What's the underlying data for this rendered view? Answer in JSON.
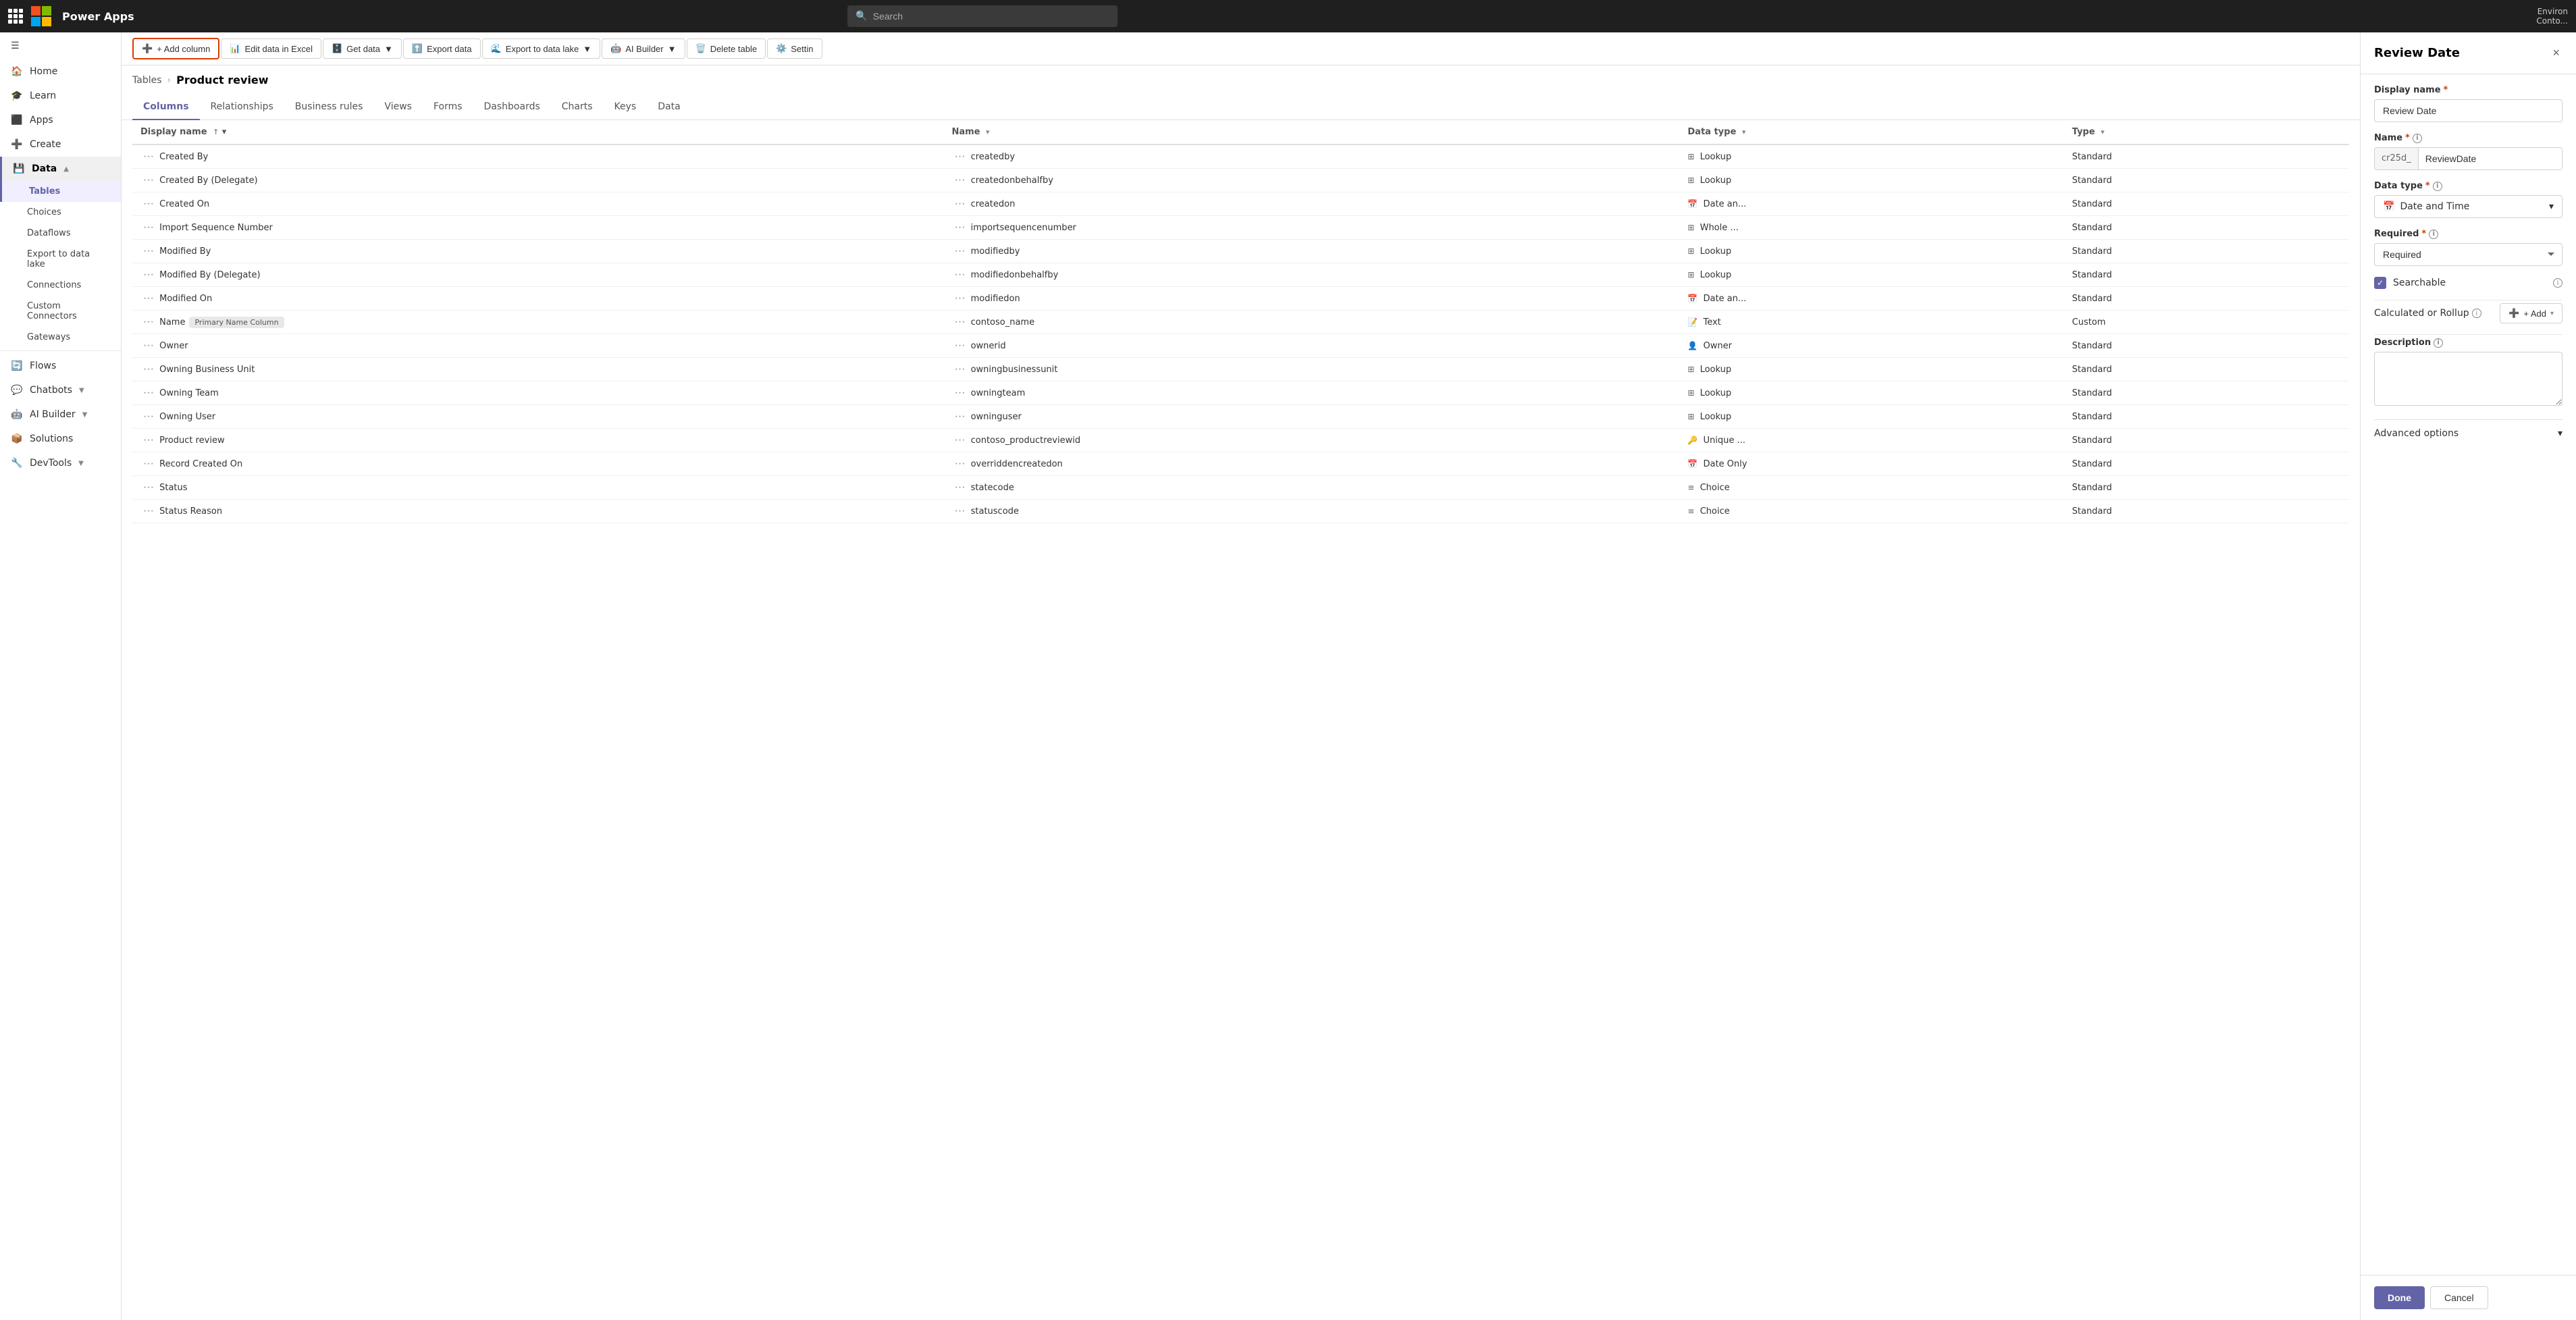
{
  "topNav": {
    "appName": "Power Apps",
    "searchPlaceholder": "Search",
    "envLabel": "Environ",
    "envUser": "Conto..."
  },
  "sidebar": {
    "menuItems": [
      {
        "id": "home",
        "label": "Home",
        "icon": "🏠",
        "active": false
      },
      {
        "id": "learn",
        "label": "Learn",
        "icon": "🎓",
        "active": false
      },
      {
        "id": "apps",
        "label": "Apps",
        "icon": "⬛",
        "active": false
      },
      {
        "id": "create",
        "label": "Create",
        "icon": "➕",
        "active": false
      },
      {
        "id": "data",
        "label": "Data",
        "icon": "💾",
        "active": true,
        "expanded": true
      }
    ],
    "dataSubItems": [
      {
        "id": "tables",
        "label": "Tables",
        "active": true
      },
      {
        "id": "choices",
        "label": "Choices",
        "active": false
      },
      {
        "id": "dataflows",
        "label": "Dataflows",
        "active": false
      },
      {
        "id": "export",
        "label": "Export to data lake",
        "active": false
      },
      {
        "id": "connections",
        "label": "Connections",
        "active": false
      },
      {
        "id": "customConnectors",
        "label": "Custom Connectors",
        "active": false
      },
      {
        "id": "gateways",
        "label": "Gateways",
        "active": false
      }
    ],
    "otherItems": [
      {
        "id": "flows",
        "label": "Flows",
        "icon": "🔄",
        "active": false
      },
      {
        "id": "chatbots",
        "label": "Chatbots",
        "icon": "💬",
        "active": false,
        "expandable": true
      },
      {
        "id": "aiBuilder",
        "label": "AI Builder",
        "icon": "🤖",
        "active": false,
        "expandable": true
      },
      {
        "id": "solutions",
        "label": "Solutions",
        "icon": "📦",
        "active": false
      },
      {
        "id": "devTools",
        "label": "DevTools",
        "icon": "🔧",
        "active": false,
        "expandable": true
      }
    ]
  },
  "breadcrumb": {
    "parent": "Tables",
    "current": "Product review"
  },
  "tabs": [
    {
      "id": "columns",
      "label": "Columns",
      "active": true
    },
    {
      "id": "relationships",
      "label": "Relationships",
      "active": false
    },
    {
      "id": "businessRules",
      "label": "Business rules",
      "active": false
    },
    {
      "id": "views",
      "label": "Views",
      "active": false
    },
    {
      "id": "forms",
      "label": "Forms",
      "active": false
    },
    {
      "id": "dashboards",
      "label": "Dashboards",
      "active": false
    },
    {
      "id": "charts",
      "label": "Charts",
      "active": false
    },
    {
      "id": "keys",
      "label": "Keys",
      "active": false
    },
    {
      "id": "data",
      "label": "Data",
      "active": false
    }
  ],
  "toolbar": {
    "addColumnLabel": "+ Add column",
    "editExcelLabel": "Edit data in Excel",
    "getDataLabel": "Get data",
    "exportDataLabel": "Export data",
    "exportDataLakeLabel": "Export to data lake",
    "aiBuilderLabel": "AI Builder",
    "deleteTableLabel": "Delete table",
    "settingsLabel": "Settin"
  },
  "tableHeaders": [
    {
      "id": "displayName",
      "label": "Display name",
      "sortable": true,
      "sorted": "asc"
    },
    {
      "id": "name",
      "label": "Name",
      "sortable": true
    },
    {
      "id": "dataType",
      "label": "Data type",
      "sortable": true
    },
    {
      "id": "type",
      "label": "Type",
      "sortable": true
    }
  ],
  "tableRows": [
    {
      "displayName": "Created By",
      "name": "createdby",
      "dataType": "Lookup",
      "dataTypeIcon": "grid",
      "type": "Standard"
    },
    {
      "displayName": "Created By (Delegate)",
      "name": "createdonbehalfby",
      "dataType": "Lookup",
      "dataTypeIcon": "grid",
      "type": "Standard"
    },
    {
      "displayName": "Created On",
      "name": "createdon",
      "dataType": "Date an...",
      "dataTypeIcon": "calendar",
      "type": "Standard"
    },
    {
      "displayName": "Import Sequence Number",
      "name": "importsequencenumber",
      "dataType": "Whole ...",
      "dataTypeIcon": "grid",
      "type": "Standard"
    },
    {
      "displayName": "Modified By",
      "name": "modifiedby",
      "dataType": "Lookup",
      "dataTypeIcon": "grid",
      "type": "Standard"
    },
    {
      "displayName": "Modified By (Delegate)",
      "name": "modifiedonbehalfby",
      "dataType": "Lookup",
      "dataTypeIcon": "grid",
      "type": "Standard"
    },
    {
      "displayName": "Modified On",
      "name": "modifiedon",
      "dataType": "Date an...",
      "dataTypeIcon": "calendar",
      "type": "Standard"
    },
    {
      "displayName": "Name",
      "name": "contoso_name",
      "badge": "Primary Name Column",
      "dataType": "Text",
      "dataTypeIcon": "text",
      "type": "Custom"
    },
    {
      "displayName": "Owner",
      "name": "ownerid",
      "dataType": "Owner",
      "dataTypeIcon": "person",
      "type": "Standard"
    },
    {
      "displayName": "Owning Business Unit",
      "name": "owningbusinessunit",
      "dataType": "Lookup",
      "dataTypeIcon": "grid",
      "type": "Standard"
    },
    {
      "displayName": "Owning Team",
      "name": "owningteam",
      "dataType": "Lookup",
      "dataTypeIcon": "grid",
      "type": "Standard"
    },
    {
      "displayName": "Owning User",
      "name": "owninguser",
      "dataType": "Lookup",
      "dataTypeIcon": "grid",
      "type": "Standard"
    },
    {
      "displayName": "Product review",
      "name": "contoso_productreviewid",
      "dataType": "Unique ...",
      "dataTypeIcon": "key",
      "type": "Standard"
    },
    {
      "displayName": "Record Created On",
      "name": "overriddencreatedon",
      "dataType": "Date Only",
      "dataTypeIcon": "calendar",
      "type": "Standard"
    },
    {
      "displayName": "Status",
      "name": "statecode",
      "dataType": "Choice",
      "dataTypeIcon": "list",
      "type": "Standard"
    },
    {
      "displayName": "Status Reason",
      "name": "statuscode",
      "dataType": "Choice",
      "dataTypeIcon": "list",
      "type": "Standard"
    }
  ],
  "rightPanel": {
    "title": "Review Date",
    "closeLabel": "×",
    "fields": {
      "displayNameLabel": "Display name",
      "displayNameValue": "Review Date",
      "nameLabel": "Name",
      "namePrefix": "cr25d_",
      "nameValue": "ReviewDate",
      "dataTypeLabel": "Data type",
      "dataTypeValue": "Date and Time",
      "dataTypeIcon": "📅",
      "requiredLabel": "Required",
      "requiredValue": "Required",
      "searchableLabel": "Searchable",
      "searchableChecked": true,
      "calcRollupLabel": "Calculated or Rollup",
      "addLabel": "+ Add",
      "descriptionLabel": "Description",
      "advancedOptionsLabel": "Advanced options"
    },
    "footer": {
      "doneLabel": "Done",
      "cancelLabel": "Cancel"
    }
  }
}
